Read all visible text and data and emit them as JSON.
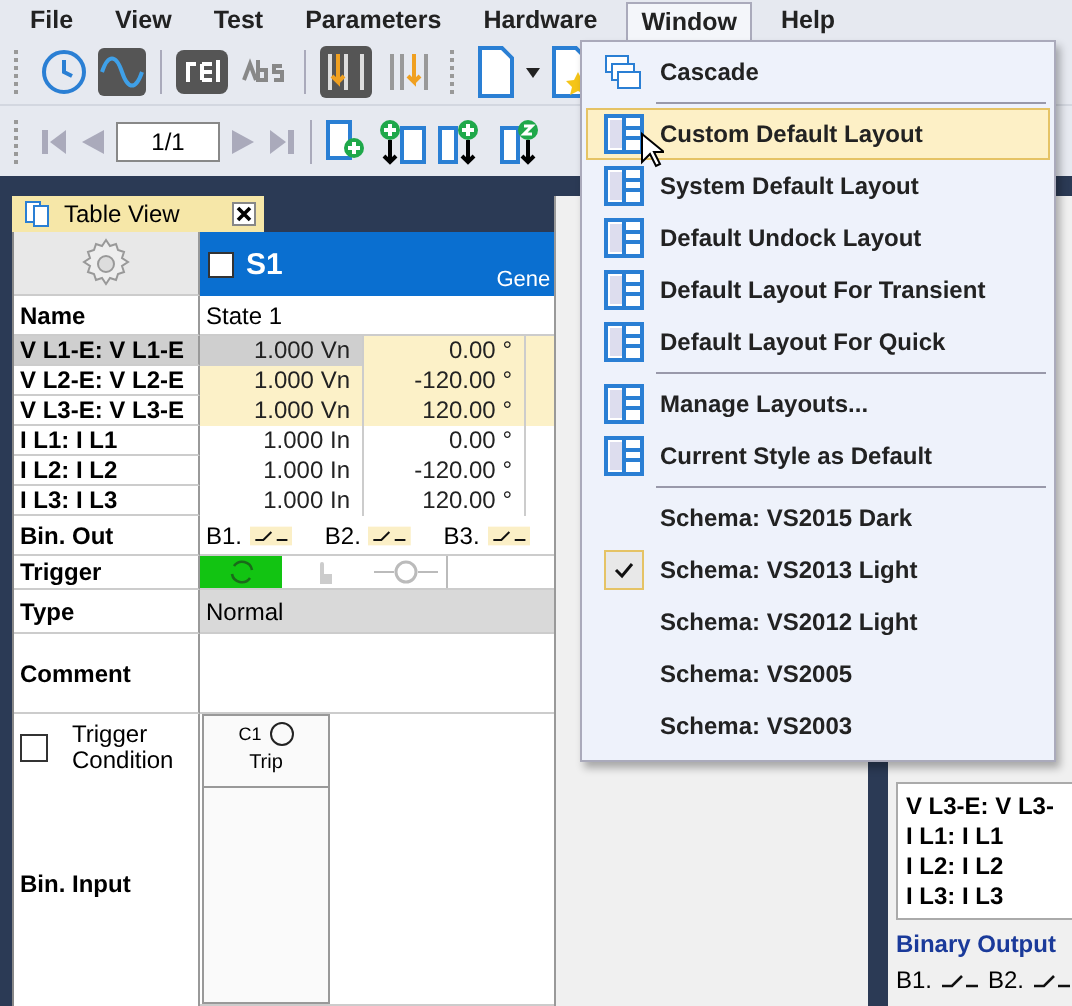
{
  "menu_bar": [
    {
      "label": "File",
      "selected": false
    },
    {
      "label": "View",
      "selected": false
    },
    {
      "label": "Test",
      "selected": false
    },
    {
      "label": "Parameters",
      "selected": false
    },
    {
      "label": "Hardware",
      "selected": false
    },
    {
      "label": "Window",
      "selected": true
    },
    {
      "label": "Help",
      "selected": false
    }
  ],
  "toolbar": {
    "page_field": "1/1"
  },
  "doc_tab": {
    "title": "Table View"
  },
  "table": {
    "state": {
      "checked": false,
      "name": "S1",
      "column_2": "Gene"
    },
    "name_row": {
      "label": "Name",
      "value": "State 1"
    },
    "analog_rows": [
      {
        "label": "V L1-E: V L1-E",
        "magnitude": "1.000 Vn",
        "phase": "0.00 °",
        "kind": "voltage",
        "selected": true
      },
      {
        "label": "V L2-E: V L2-E",
        "magnitude": "1.000 Vn",
        "phase": "-120.00 °",
        "kind": "voltage",
        "selected": false
      },
      {
        "label": "V L3-E: V L3-E",
        "magnitude": "1.000 Vn",
        "phase": "120.00 °",
        "kind": "voltage",
        "selected": false
      },
      {
        "label": "I L1: I L1",
        "magnitude": "1.000 In",
        "phase": "0.00 °",
        "kind": "current",
        "selected": false
      },
      {
        "label": "I L2: I L2",
        "magnitude": "1.000 In",
        "phase": "-120.00 °",
        "kind": "current",
        "selected": false
      },
      {
        "label": "I L3: I L3",
        "magnitude": "1.000 In",
        "phase": "120.00 °",
        "kind": "current",
        "selected": false
      }
    ],
    "bin_out": {
      "label": "Bin. Out",
      "outputs": [
        "B1.",
        "B2.",
        "B3."
      ]
    },
    "trigger": {
      "label": "Trigger",
      "options": [
        {
          "kind": "loop",
          "selected": true
        },
        {
          "kind": "hand",
          "selected": false
        },
        {
          "kind": "timer",
          "selected": false
        }
      ]
    },
    "type": {
      "label": "Type",
      "value": "Normal"
    },
    "comment": {
      "label": "Comment"
    },
    "trigger_condition": {
      "label": "Trigger Condition",
      "checked": false
    },
    "bin_input": {
      "label": "Bin. Input",
      "channels": [
        {
          "name": "C1",
          "caption": "Trip",
          "on": false
        }
      ]
    }
  },
  "right_panel": {
    "rows": [
      "V L3-E: V L3-",
      "I L1: I L1",
      "I L2: I L2",
      "I L3: I L3"
    ],
    "binary_output": {
      "title": "Binary Output",
      "outputs": [
        "B1.",
        "B2."
      ]
    }
  },
  "window_menu": [
    {
      "kind": "cascade",
      "label": "Cascade",
      "selected": false,
      "checked": false
    },
    {
      "kind": "separator"
    },
    {
      "kind": "layout",
      "label": "Custom Default Layout",
      "selected": true,
      "checked": false
    },
    {
      "kind": "layout",
      "label": "System Default Layout",
      "selected": false,
      "checked": false
    },
    {
      "kind": "layout",
      "label": "Default Undock Layout",
      "selected": false,
      "checked": false
    },
    {
      "kind": "layout",
      "label": "Default Layout For Transient",
      "selected": false,
      "checked": false
    },
    {
      "kind": "layout",
      "label": "Default Layout For Quick",
      "selected": false,
      "checked": false
    },
    {
      "kind": "separator"
    },
    {
      "kind": "layout",
      "label": "Manage Layouts...",
      "selected": false,
      "checked": false
    },
    {
      "kind": "layout",
      "label": "Current Style as Default",
      "selected": false,
      "checked": false
    },
    {
      "kind": "separator"
    },
    {
      "kind": "schema",
      "label": "Schema: VS2015 Dark",
      "selected": false,
      "checked": false
    },
    {
      "kind": "schema",
      "label": "Schema: VS2013 Light",
      "selected": false,
      "checked": true
    },
    {
      "kind": "schema",
      "label": "Schema: VS2012 Light",
      "selected": false,
      "checked": false
    },
    {
      "kind": "schema",
      "label": "Schema: VS2005",
      "selected": false,
      "checked": false
    },
    {
      "kind": "schema",
      "label": "Schema: VS2003",
      "selected": false,
      "checked": false
    }
  ]
}
